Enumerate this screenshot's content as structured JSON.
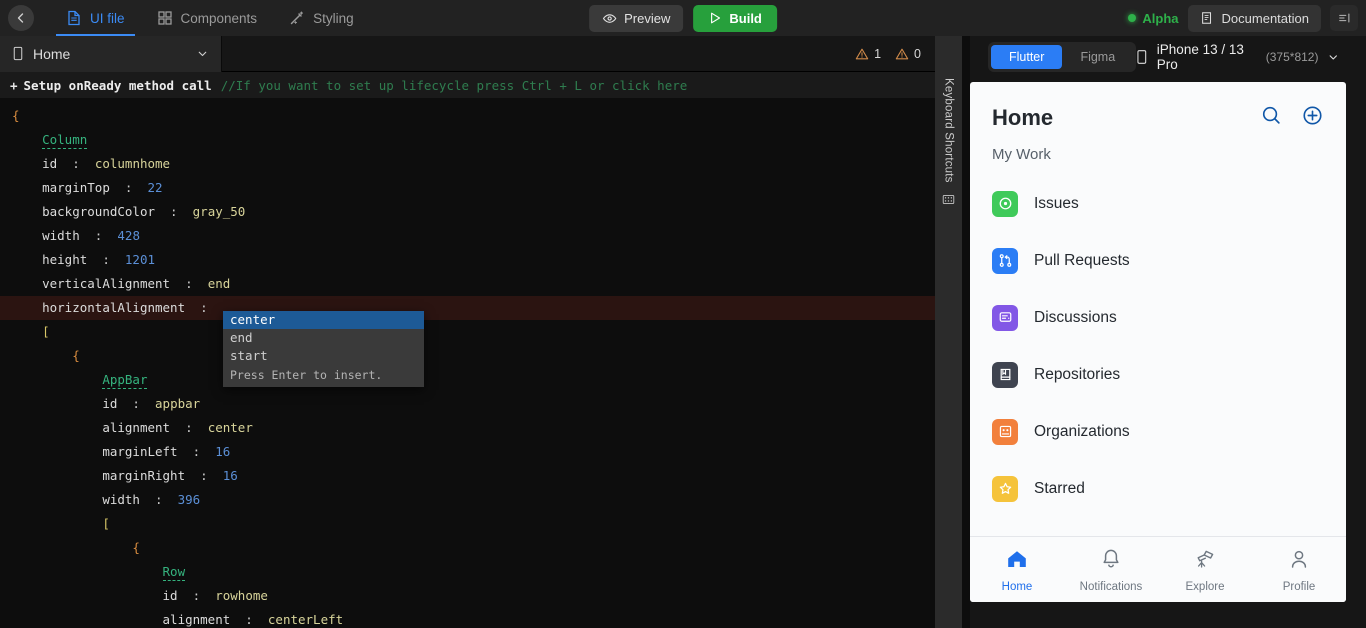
{
  "topbar": {
    "back_icon": "chevron-left-icon",
    "tabs": [
      {
        "label": "UI file",
        "icon": "document-icon",
        "active": true
      },
      {
        "label": "Components",
        "icon": "grid-icon",
        "active": false
      },
      {
        "label": "Styling",
        "icon": "magic-wand-icon",
        "active": false
      }
    ],
    "preview_label": "Preview",
    "build_label": "Build",
    "alpha_label": "Alpha",
    "documentation_label": "Documentation",
    "panel_toggle_icon": "panel-right-icon",
    "accent_blue": "#3b8bf5",
    "build_green": "#27a03c",
    "alpha_green": "#2eb14a"
  },
  "filebar": {
    "file_name": "Home",
    "file_icon": "mobile-icon",
    "chevron": "chevron-down-icon",
    "warnings_count": "1",
    "errors_count": "0"
  },
  "onready": {
    "plus": "+",
    "label": "Setup onReady method call",
    "comment": "//If you want to set up lifecycle press Ctrl + L or click here"
  },
  "code": {
    "lines": [
      {
        "indent": 0,
        "tokens": [
          {
            "t": "brace",
            "v": "{"
          }
        ]
      },
      {
        "indent": 1,
        "tokens": [
          {
            "t": "widget",
            "v": "Column"
          }
        ]
      },
      {
        "indent": 1,
        "tokens": [
          {
            "t": "key",
            "v": "id"
          },
          {
            "t": "colon",
            "v": "  :  "
          },
          {
            "t": "str",
            "v": "columnhome"
          }
        ]
      },
      {
        "indent": 1,
        "tokens": [
          {
            "t": "key",
            "v": "marginTop"
          },
          {
            "t": "colon",
            "v": "  :  "
          },
          {
            "t": "num",
            "v": "22"
          }
        ]
      },
      {
        "indent": 1,
        "tokens": [
          {
            "t": "key",
            "v": "backgroundColor"
          },
          {
            "t": "colon",
            "v": "  :  "
          },
          {
            "t": "str",
            "v": "gray_50"
          }
        ]
      },
      {
        "indent": 1,
        "tokens": [
          {
            "t": "key",
            "v": "width"
          },
          {
            "t": "colon",
            "v": "  :  "
          },
          {
            "t": "num",
            "v": "428"
          }
        ]
      },
      {
        "indent": 1,
        "tokens": [
          {
            "t": "key",
            "v": "height"
          },
          {
            "t": "colon",
            "v": "  :  "
          },
          {
            "t": "num",
            "v": "1201"
          }
        ]
      },
      {
        "indent": 1,
        "tokens": [
          {
            "t": "key",
            "v": "verticalAlignment"
          },
          {
            "t": "colon",
            "v": "  :  "
          },
          {
            "t": "str",
            "v": "end"
          }
        ]
      },
      {
        "indent": 1,
        "active": true,
        "tokens": [
          {
            "t": "key",
            "v": "horizontalAlignment"
          },
          {
            "t": "colon",
            "v": "  :  "
          }
        ]
      },
      {
        "indent": 1,
        "tokens": [
          {
            "t": "bracket",
            "v": "["
          }
        ]
      },
      {
        "indent": 2,
        "tokens": [
          {
            "t": "brace",
            "v": "{"
          }
        ]
      },
      {
        "indent": 3,
        "tokens": [
          {
            "t": "widget",
            "v": "AppBar"
          }
        ]
      },
      {
        "indent": 3,
        "tokens": [
          {
            "t": "key",
            "v": "id"
          },
          {
            "t": "colon",
            "v": "  :  "
          },
          {
            "t": "str",
            "v": "appbar"
          }
        ]
      },
      {
        "indent": 3,
        "tokens": [
          {
            "t": "key",
            "v": "alignment"
          },
          {
            "t": "colon",
            "v": "  :  "
          },
          {
            "t": "str",
            "v": "center"
          }
        ]
      },
      {
        "indent": 3,
        "tokens": [
          {
            "t": "key",
            "v": "marginLeft"
          },
          {
            "t": "colon",
            "v": "  :  "
          },
          {
            "t": "num",
            "v": "16"
          }
        ]
      },
      {
        "indent": 3,
        "tokens": [
          {
            "t": "key",
            "v": "marginRight"
          },
          {
            "t": "colon",
            "v": "  :  "
          },
          {
            "t": "num",
            "v": "16"
          }
        ]
      },
      {
        "indent": 3,
        "tokens": [
          {
            "t": "key",
            "v": "width"
          },
          {
            "t": "colon",
            "v": "  :  "
          },
          {
            "t": "num",
            "v": "396"
          }
        ]
      },
      {
        "indent": 3,
        "tokens": [
          {
            "t": "bracket",
            "v": "["
          }
        ]
      },
      {
        "indent": 4,
        "tokens": [
          {
            "t": "brace",
            "v": "{"
          }
        ]
      },
      {
        "indent": 5,
        "tokens": [
          {
            "t": "widget",
            "v": "Row"
          }
        ]
      },
      {
        "indent": 5,
        "tokens": [
          {
            "t": "key",
            "v": "id"
          },
          {
            "t": "colon",
            "v": "  :  "
          },
          {
            "t": "str",
            "v": "rowhome"
          }
        ]
      },
      {
        "indent": 5,
        "tokens": [
          {
            "t": "key",
            "v": "alignment"
          },
          {
            "t": "colon",
            "v": "  :  "
          },
          {
            "t": "str",
            "v": "centerLeft"
          }
        ]
      }
    ]
  },
  "autocomplete": {
    "options": [
      {
        "label": "center",
        "selected": true
      },
      {
        "label": "end",
        "selected": false
      },
      {
        "label": "start",
        "selected": false
      }
    ],
    "hint": "Press Enter to insert."
  },
  "shortcuts_strip": {
    "label": "Keyboard Shortcuts",
    "icon": "keyboard-icon"
  },
  "preview_bar": {
    "segments": [
      {
        "label": "Flutter",
        "active": true
      },
      {
        "label": "Figma",
        "active": false
      }
    ],
    "device_icon": "mobile-icon",
    "device_name": "iPhone 13 / 13 Pro",
    "device_dimensions": "(375*812)",
    "chevron": "chevron-down-icon"
  },
  "phone": {
    "title": "Home",
    "search_icon": "search-icon",
    "add_icon": "plus-circle-icon",
    "section_label": "My Work",
    "items": [
      {
        "label": "Issues",
        "icon": "issue-opened-icon",
        "color": "#3fca5a"
      },
      {
        "label": "Pull Requests",
        "icon": "git-pull-request-icon",
        "color": "#2b7df5"
      },
      {
        "label": "Discussions",
        "icon": "comment-discussion-icon",
        "color": "#8257e6"
      },
      {
        "label": "Repositories",
        "icon": "repo-icon",
        "color": "#3f4450"
      },
      {
        "label": "Organizations",
        "icon": "organization-icon",
        "color": "#f2803c"
      },
      {
        "label": "Starred",
        "icon": "star-icon",
        "color": "#f5c33b"
      }
    ],
    "nav": [
      {
        "label": "Home",
        "icon": "home-icon",
        "active": true
      },
      {
        "label": "Notifications",
        "icon": "bell-icon",
        "active": false
      },
      {
        "label": "Explore",
        "icon": "telescope-icon",
        "active": false
      },
      {
        "label": "Profile",
        "icon": "person-icon",
        "active": false
      }
    ],
    "active_blue": "#1f6feb"
  }
}
